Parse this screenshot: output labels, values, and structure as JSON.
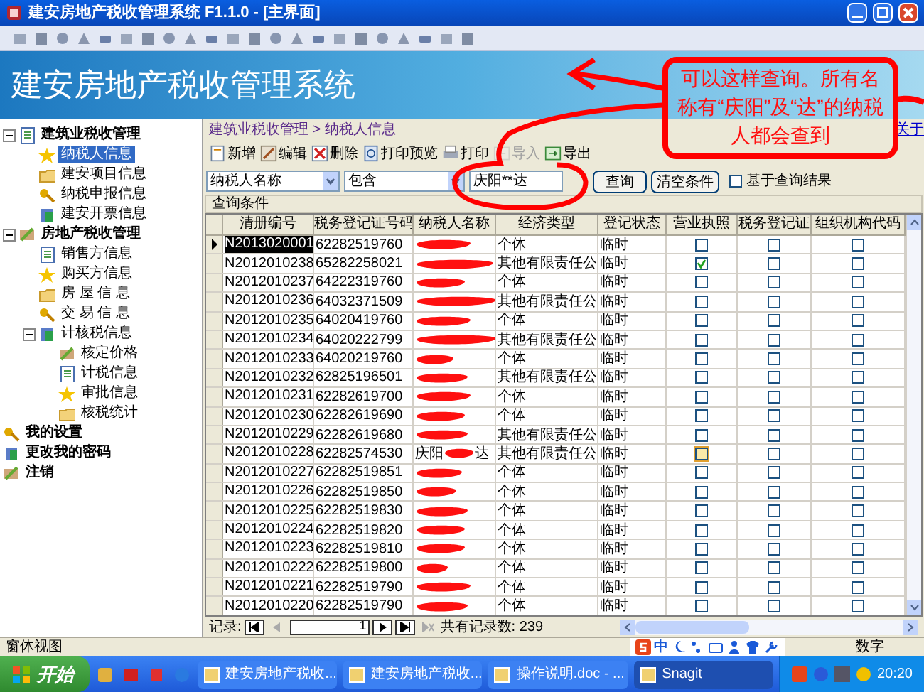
{
  "window": {
    "title": "建安房地产税收管理系统 F1.1.0 - [主界面]"
  },
  "banner": {
    "title": "建安房地产税收管理系统"
  },
  "tree": [
    {
      "label": "建筑业税收管理",
      "bold": true,
      "expanded": true,
      "selected": false,
      "children": [
        {
          "label": "纳税人信息",
          "selected": true
        },
        {
          "label": "建安项目信息",
          "selected": false
        },
        {
          "label": "纳税申报信息",
          "selected": false
        },
        {
          "label": "建安开票信息",
          "selected": false
        }
      ]
    },
    {
      "label": "房地产税收管理",
      "bold": true,
      "expanded": true,
      "selected": false,
      "children": [
        {
          "label": "销售方信息",
          "selected": false
        },
        {
          "label": "购买方信息",
          "selected": false
        },
        {
          "label": "房 屋 信 息",
          "selected": false
        },
        {
          "label": "交 易 信 息",
          "selected": false
        },
        {
          "label": "计核税信息",
          "expanded": true,
          "selected": false,
          "children": [
            {
              "label": "核定价格",
              "selected": false
            },
            {
              "label": "计税信息",
              "selected": false
            },
            {
              "label": "审批信息",
              "selected": false
            },
            {
              "label": "核税统计",
              "selected": false
            }
          ]
        }
      ]
    },
    {
      "label": "我的设置",
      "bold": true,
      "selected": false
    },
    {
      "label": "更改我的密码",
      "bold": true,
      "selected": false
    },
    {
      "label": "注销",
      "bold": true,
      "selected": false
    }
  ],
  "breadcrumb": "建筑业税收管理 > 纳税人信息",
  "about_link": "关于",
  "actions": [
    {
      "label": "新增",
      "disabled": false
    },
    {
      "label": "编辑",
      "disabled": false
    },
    {
      "label": "删除",
      "disabled": false
    },
    {
      "label": "打印预览",
      "disabled": false
    },
    {
      "label": "打印",
      "disabled": false
    },
    {
      "label": "导入",
      "disabled": true
    },
    {
      "label": "导出",
      "disabled": false
    }
  ],
  "filter": {
    "field": "纳税人名称",
    "operator": "包含",
    "value": "庆阳**达",
    "search_button": "查询",
    "clear_button": "清空条件",
    "within_results": {
      "label": "基于查询结果",
      "checked": false
    }
  },
  "conditions_bar": "查询条件",
  "table": {
    "columns": [
      "清册编号",
      "税务登记证号码",
      "纳税人名称",
      "经济类型",
      "登记状态",
      "营业执照",
      "税务登记证",
      "组织机构代码"
    ],
    "rows": [
      {
        "id": "N2013020001",
        "reg_no": "62282519760",
        "redacted": true,
        "type": "个体",
        "status": "临时",
        "license": false,
        "focused": false,
        "tax_cert": false,
        "org_code": false,
        "selected": true
      },
      {
        "id": "N2012010238",
        "reg_no": "65282258021",
        "redacted": true,
        "type": "其他有限责任公",
        "status": "临时",
        "license": true,
        "focused": false,
        "tax_cert": false,
        "org_code": false,
        "selected": false
      },
      {
        "id": "N2012010237",
        "reg_no": "64222319760",
        "redacted": true,
        "type": "个体",
        "status": "临时",
        "license": false,
        "focused": false,
        "tax_cert": false,
        "org_code": false,
        "selected": false
      },
      {
        "id": "N2012010236",
        "reg_no": "64032371509",
        "redacted": true,
        "type": "其他有限责任公",
        "status": "临时",
        "license": false,
        "focused": false,
        "tax_cert": false,
        "org_code": false,
        "selected": false
      },
      {
        "id": "N2012010235",
        "reg_no": "64020419760",
        "redacted": true,
        "type": "个体",
        "status": "临时",
        "license": false,
        "focused": false,
        "tax_cert": false,
        "org_code": false,
        "selected": false
      },
      {
        "id": "N2012010234",
        "reg_no": "64020222799",
        "redacted": true,
        "type": "其他有限责任公",
        "status": "临时",
        "license": false,
        "focused": false,
        "tax_cert": false,
        "org_code": false,
        "selected": false
      },
      {
        "id": "N2012010233",
        "reg_no": "64020219760",
        "redacted": true,
        "type": "个体",
        "status": "临时",
        "license": false,
        "focused": false,
        "tax_cert": false,
        "org_code": false,
        "selected": false
      },
      {
        "id": "N2012010232",
        "reg_no": "62825196501",
        "redacted": true,
        "type": "其他有限责任公",
        "status": "临时",
        "license": false,
        "focused": false,
        "tax_cert": false,
        "org_code": false,
        "selected": false
      },
      {
        "id": "N2012010231",
        "reg_no": "62282619700",
        "redacted": true,
        "type": "个体",
        "status": "临时",
        "license": false,
        "focused": false,
        "tax_cert": false,
        "org_code": false,
        "selected": false
      },
      {
        "id": "N2012010230",
        "reg_no": "62282619690",
        "redacted": true,
        "type": "个体",
        "status": "临时",
        "license": false,
        "focused": false,
        "tax_cert": false,
        "org_code": false,
        "selected": false
      },
      {
        "id": "N2012010229",
        "reg_no": "62282619680",
        "redacted": true,
        "type": "其他有限责任公",
        "status": "临时",
        "license": false,
        "focused": false,
        "tax_cert": false,
        "org_code": false,
        "selected": false
      },
      {
        "id": "N2012010228",
        "reg_no": "62282574530",
        "name_start": "庆阳",
        "name_end": "达",
        "redacted": true,
        "type": "其他有限责任公",
        "status": "临时",
        "license": false,
        "focused": true,
        "tax_cert": false,
        "org_code": false,
        "selected": false
      },
      {
        "id": "N2012010227",
        "reg_no": "62282519851",
        "redacted": true,
        "type": "个体",
        "status": "临时",
        "license": false,
        "focused": false,
        "tax_cert": false,
        "org_code": false,
        "selected": false
      },
      {
        "id": "N2012010226",
        "reg_no": "62282519850",
        "redacted": true,
        "type": "个体",
        "status": "临时",
        "license": false,
        "focused": false,
        "tax_cert": false,
        "org_code": false,
        "selected": false
      },
      {
        "id": "N2012010225",
        "reg_no": "62282519830",
        "redacted": true,
        "type": "个体",
        "status": "临时",
        "license": false,
        "focused": false,
        "tax_cert": false,
        "org_code": false,
        "selected": false
      },
      {
        "id": "N2012010224",
        "reg_no": "62282519820",
        "redacted": true,
        "type": "个体",
        "status": "临时",
        "license": false,
        "focused": false,
        "tax_cert": false,
        "org_code": false,
        "selected": false
      },
      {
        "id": "N2012010223",
        "reg_no": "62282519810",
        "redacted": true,
        "type": "个体",
        "status": "临时",
        "license": false,
        "focused": false,
        "tax_cert": false,
        "org_code": false,
        "selected": false
      },
      {
        "id": "N2012010222",
        "reg_no": "62282519800",
        "redacted": true,
        "type": "个体",
        "status": "临时",
        "license": false,
        "focused": false,
        "tax_cert": false,
        "org_code": false,
        "selected": false
      },
      {
        "id": "N2012010221",
        "reg_no": "62282519790",
        "redacted": true,
        "type": "个体",
        "status": "临时",
        "license": false,
        "focused": false,
        "tax_cert": false,
        "org_code": false,
        "selected": false
      },
      {
        "id": "N2012010220",
        "reg_no": "62282519790",
        "redacted": true,
        "type": "个体",
        "status": "临时",
        "license": false,
        "focused": false,
        "tax_cert": false,
        "org_code": false,
        "selected": false
      }
    ]
  },
  "navigator": {
    "label": "记录:",
    "current": "1",
    "total": "共有记录数: 239"
  },
  "status_bar": {
    "view": "窗体视图",
    "ime": "中",
    "mode": "数字"
  },
  "taskbar": {
    "start": "开始",
    "tasks": [
      {
        "label": "建安房地产税收...",
        "selected": false
      },
      {
        "label": "建安房地产税收...",
        "selected": false
      },
      {
        "label": "操作说明.doc - ...",
        "selected": false
      },
      {
        "label": "Snagit",
        "selected": true
      }
    ],
    "clock": "20:20"
  },
  "annotation": {
    "text": "可以这样查询。所有名称有“庆阳”及“达”的纳税人都会查到"
  }
}
